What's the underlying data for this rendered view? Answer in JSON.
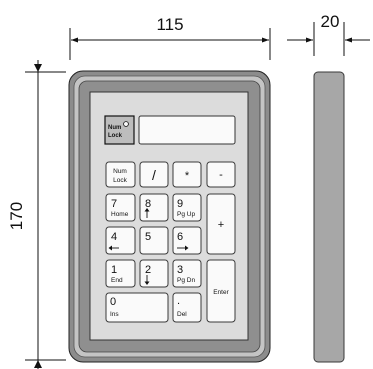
{
  "dimensions": {
    "width": "115",
    "depth": "20",
    "height": "170"
  },
  "indicator": {
    "line1": "Num",
    "line2": "Lock"
  },
  "keys": {
    "numlock": {
      "top": "Num",
      "bottom": "Lock"
    },
    "divide": {
      "label": "/"
    },
    "multiply": {
      "label": "*"
    },
    "minus": {
      "label": "-"
    },
    "k7": {
      "top": "7",
      "bottom": "Home"
    },
    "k8": {
      "top": "8"
    },
    "k9": {
      "top": "9",
      "bottom": "Pg Up"
    },
    "plus": {
      "label": "+"
    },
    "k4": {
      "top": "4"
    },
    "k5": {
      "top": "5"
    },
    "k6": {
      "top": "6"
    },
    "k1": {
      "top": "1",
      "bottom": "End"
    },
    "k2": {
      "top": "2"
    },
    "k3": {
      "top": "3",
      "bottom": "Pg Dn"
    },
    "enter": {
      "label": "Enter"
    },
    "k0": {
      "top": "0",
      "bottom": "Ins"
    },
    "dot": {
      "top": ".",
      "bottom": "Del"
    }
  }
}
